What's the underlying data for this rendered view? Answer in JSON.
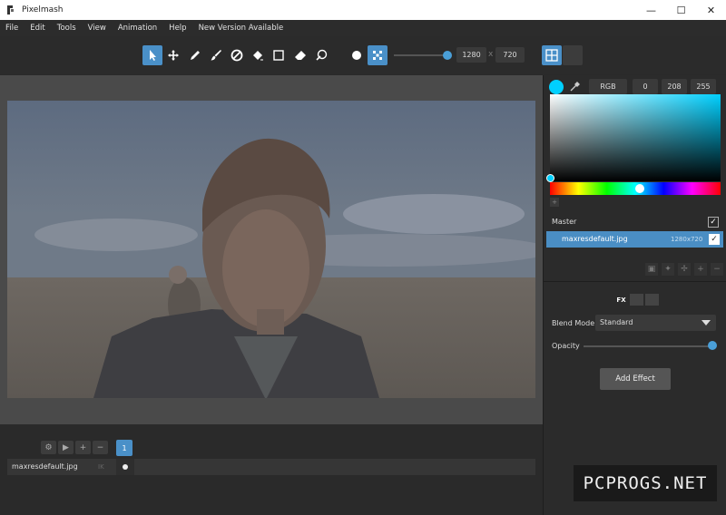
{
  "app": {
    "title": "Pixelmash",
    "window_controls": {
      "minimize": "—",
      "maximize": "☐",
      "close": "✕"
    }
  },
  "menu": [
    "File",
    "Edit",
    "Tools",
    "View",
    "Animation",
    "Help",
    "New Version Available"
  ],
  "toolbar": {
    "tools": [
      {
        "name": "select-tool",
        "icon": "cursor-icon",
        "active": true
      },
      {
        "name": "move-tool",
        "icon": "move-arrows-icon",
        "active": false
      },
      {
        "name": "pencil-tool",
        "icon": "pencil-icon",
        "active": false
      },
      {
        "name": "brush-tool",
        "icon": "brush-icon",
        "active": false
      },
      {
        "name": "disable-tool",
        "icon": "circle-slash-icon",
        "active": false
      },
      {
        "name": "fill-tool",
        "icon": "paint-bucket-icon",
        "active": false
      },
      {
        "name": "rectangle-tool",
        "icon": "rectangle-icon",
        "active": false
      },
      {
        "name": "eraser-tool",
        "icon": "eraser-icon",
        "active": false
      },
      {
        "name": "pen-tool",
        "icon": "pen-nib-icon",
        "active": false
      },
      {
        "name": "circle-shape-tool",
        "icon": "dot-icon",
        "active": false
      },
      {
        "name": "pixel-pattern-tool",
        "icon": "pixel-pattern-icon",
        "active": true
      }
    ],
    "size_slider_value": 0.95,
    "width": "1280",
    "height": "720",
    "separator": "x",
    "view_modes": [
      {
        "name": "grid-view",
        "icon": "grid-icon",
        "active": true
      },
      {
        "name": "single-view",
        "icon": "blank-square-icon",
        "active": false
      }
    ]
  },
  "color": {
    "swatch": "#00d0ff",
    "mode": "RGB",
    "r": "0",
    "g": "208",
    "b": "255"
  },
  "layers": {
    "master_label": "Master",
    "master_checked": true,
    "items": [
      {
        "name": "maxresdefault.jpg",
        "size": "1280x720",
        "checked": true,
        "selected": true
      }
    ]
  },
  "effects": {
    "blend_mode_label": "Blend Mode",
    "blend_mode_value": "Standard",
    "opacity_label": "Opacity",
    "opacity_value": 1.0,
    "add_effect_label": "Add Effect",
    "tabs": [
      "FX",
      "",
      ""
    ]
  },
  "timeline": {
    "frame_number": "1",
    "layer_name": "maxresdefault.jpg",
    "layer_badge": "IK"
  },
  "watermark": "PCPROGS.NET",
  "colors": {
    "accent": "#4a90c8",
    "panel": "#2b2b2b",
    "canvas_bg": "#4a4a4a"
  }
}
